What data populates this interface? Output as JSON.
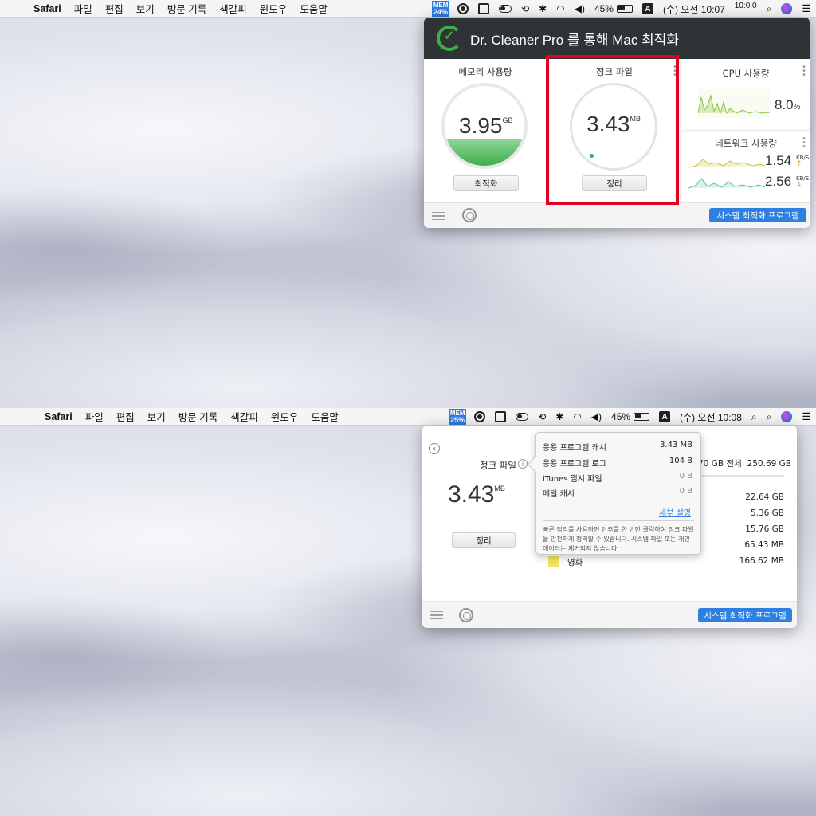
{
  "menubar": {
    "apple": "",
    "items": [
      "Safari",
      "파일",
      "편집",
      "보기",
      "방문 기록",
      "책갈피",
      "윈도우",
      "도움말"
    ],
    "mem_label": "MEM",
    "top_mem_pct": "24%",
    "bot_mem_pct": "25%",
    "battery": "45%",
    "input_source": "A",
    "top_clock": "(수) 오전 10:07",
    "bot_clock": "(수) 오전 10:08",
    "top_clock_extra": "10:0:0",
    "search_icon": "⌕",
    "list_icon": "☰"
  },
  "top_panel": {
    "title": "Dr. Cleaner Pro 를 통해 Mac 최적화",
    "memory": {
      "title": "메모리 사용량",
      "value": "3.95",
      "unit": "GB",
      "button": "최적화"
    },
    "junk": {
      "title": "정크 파일",
      "value": "3.43",
      "unit": "MB",
      "button": "정리"
    },
    "cpu": {
      "title": "CPU 사용량",
      "value": "8.0",
      "unit": "%"
    },
    "network": {
      "title": "네트워크 사용량",
      "up_value": "1.54",
      "down_value": "2.56",
      "unit": "KB/S",
      "up_arrow": "↑",
      "down_arrow": "↓"
    },
    "footer_button": "시스템 최적화 프로그램"
  },
  "bottom_panel": {
    "junk_title": "정크 파일",
    "junk_value": "3.43",
    "junk_unit": "MB",
    "junk_button": "정리",
    "info_icon": "i",
    "back_icon": "‹",
    "disk_summary": "70 GB 전체: 250.69 GB",
    "sizes": [
      "22.64 GB",
      "5.36 GB",
      "15.76 GB",
      "65.43 MB"
    ],
    "movie_label": "영화",
    "movie_size": "166.62 MB",
    "footer_button": "시스템 최적화 프로그램"
  },
  "tooltip": {
    "rows": [
      {
        "label": "응용 프로그램 캐시",
        "value": "3.43 MB"
      },
      {
        "label": "응용 프로그램 로그",
        "value": "104 B"
      },
      {
        "label": "iTunes 임시 파일",
        "value": "0 B"
      },
      {
        "label": "메일 캐시",
        "value": "0 B"
      }
    ],
    "link": "세부 설명",
    "description": "빠른 정리를 사용하면 단추를 한 번만 클릭하여 정크 파일을 안전하게 정리할 수 있습니다. 시스템 파일 또는 개인 데이터는 제거되지 않습니다."
  },
  "colors": {
    "accent_blue": "#2d7fe0",
    "brand_green": "#3fae49",
    "highlight_red": "#e6001f",
    "header_dark": "#2f3336"
  }
}
